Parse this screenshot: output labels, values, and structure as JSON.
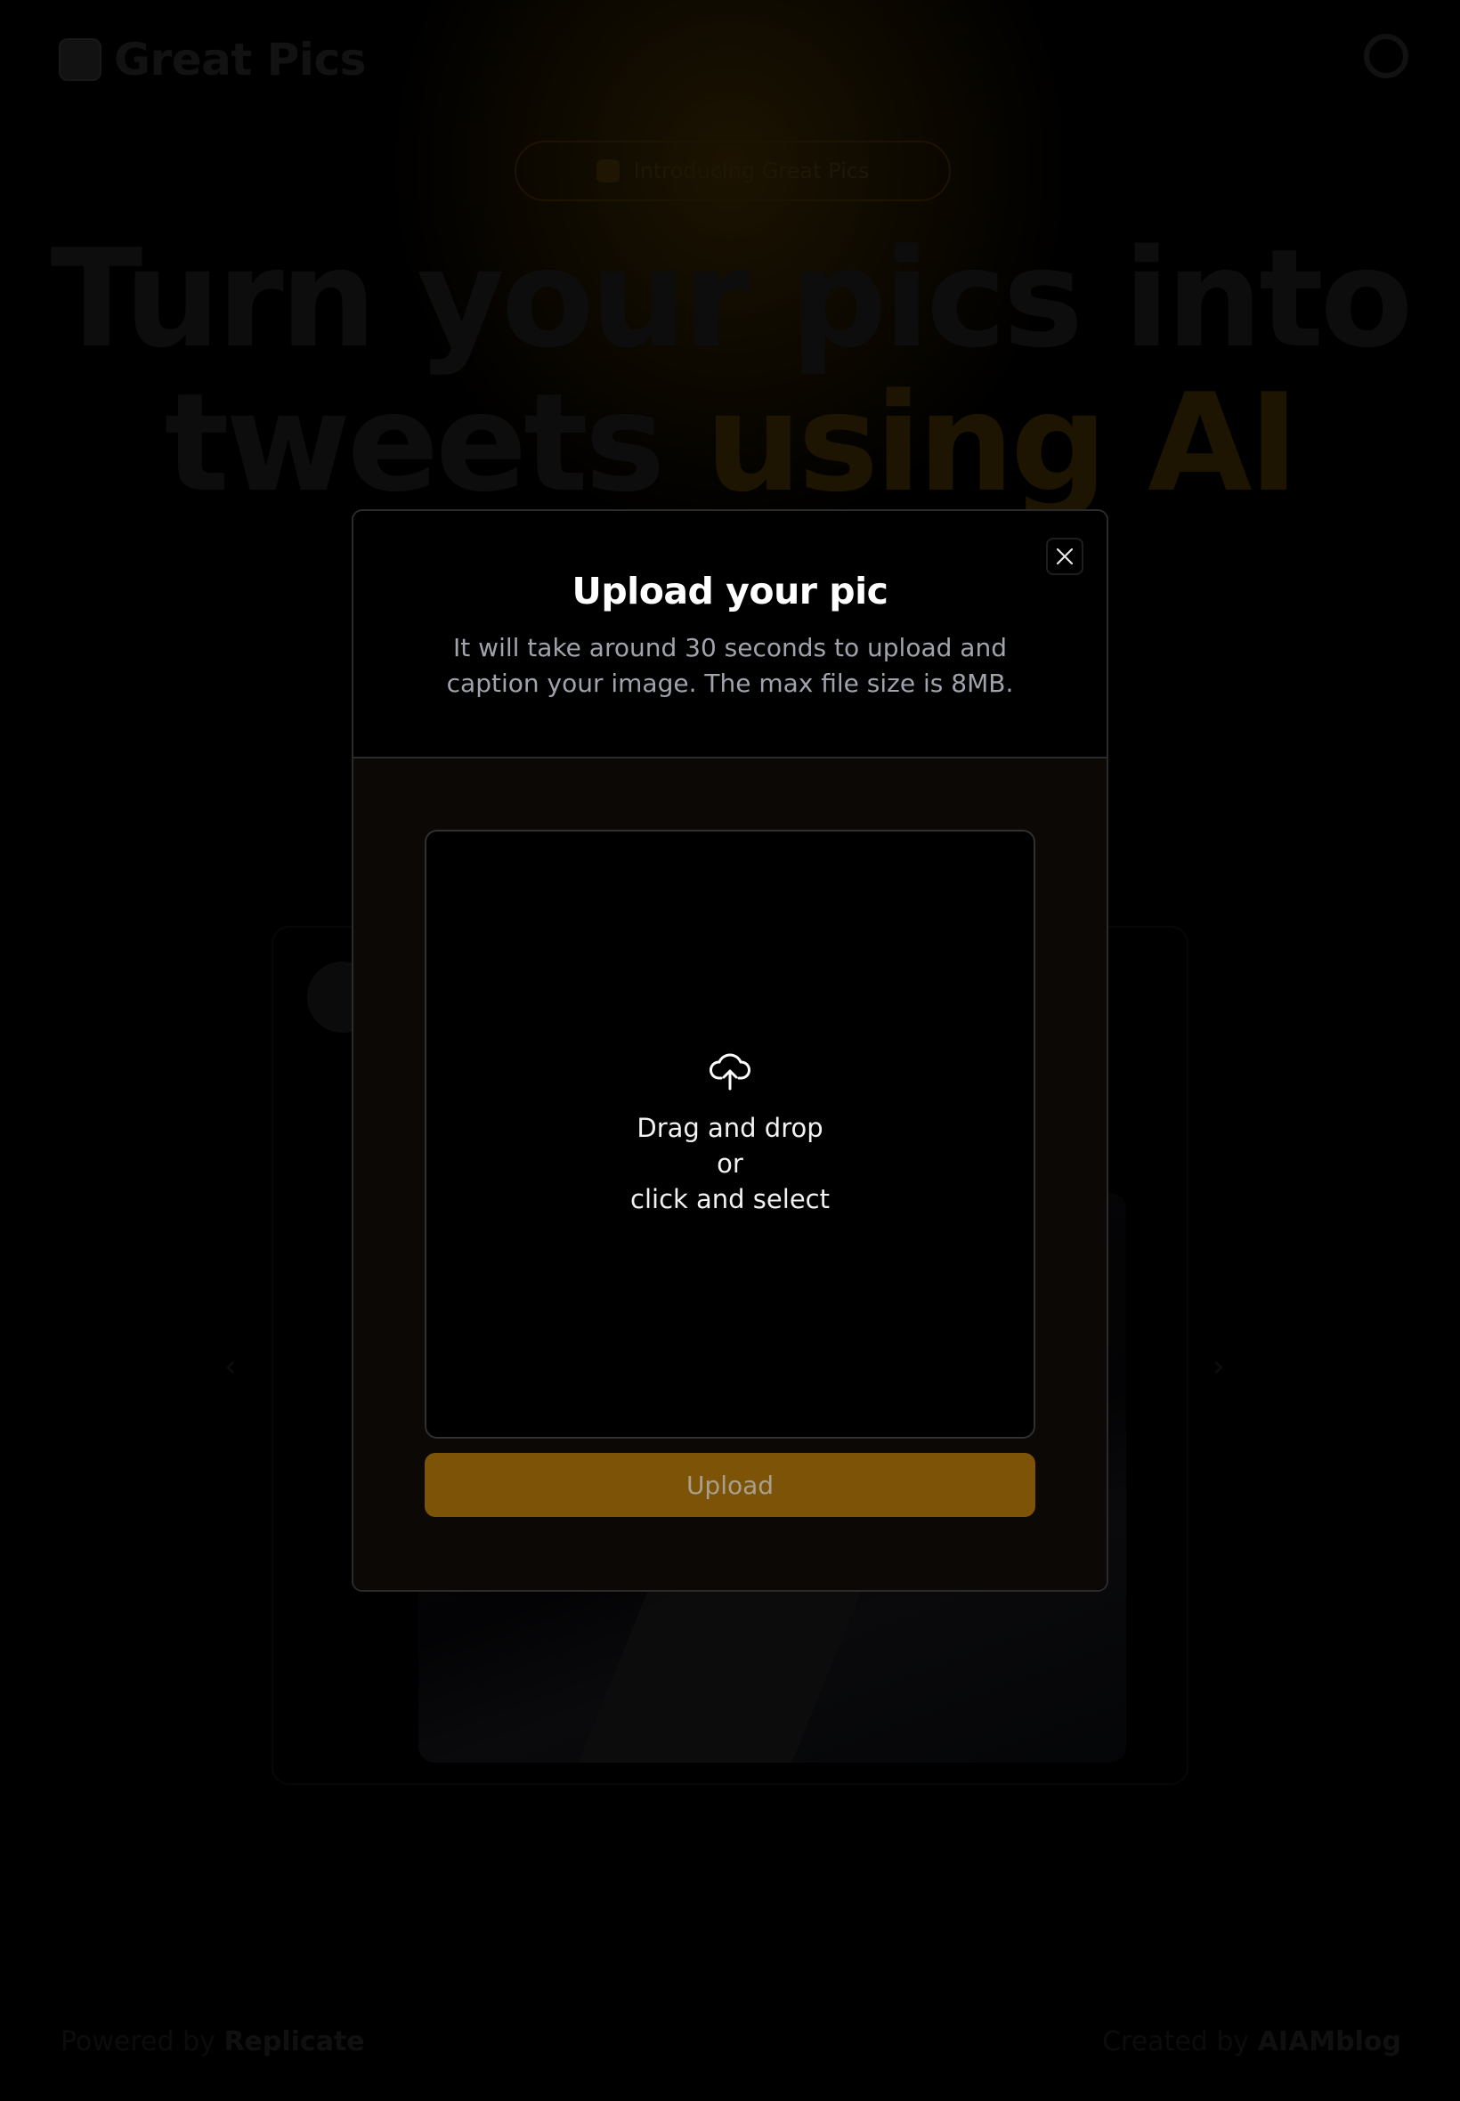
{
  "background": {
    "brand": "Great Pics",
    "announcement": "Introducing Great Pics",
    "hero": {
      "line1": "Turn your pics into",
      "line2_plain": "tweets",
      "line2_accent": "using AI"
    },
    "footer": {
      "left_prefix": "Powered by",
      "left_name": "Replicate",
      "right_prefix": "Created by",
      "right_name": "AIAMblog"
    }
  },
  "modal": {
    "title": "Upload your pic",
    "description": "It will take around 30 seconds to upload and caption your image. The max file size is 8MB.",
    "dropzone": {
      "line1": "Drag and drop",
      "line2": "or",
      "line3": "click and select"
    },
    "upload_button": "Upload"
  },
  "icons": {
    "close": "close-icon",
    "upload": "cloud-upload-icon"
  },
  "colors": {
    "accent": "#7d5407",
    "modal_body": "#0b0805",
    "text_muted": "#a0a3ab"
  }
}
